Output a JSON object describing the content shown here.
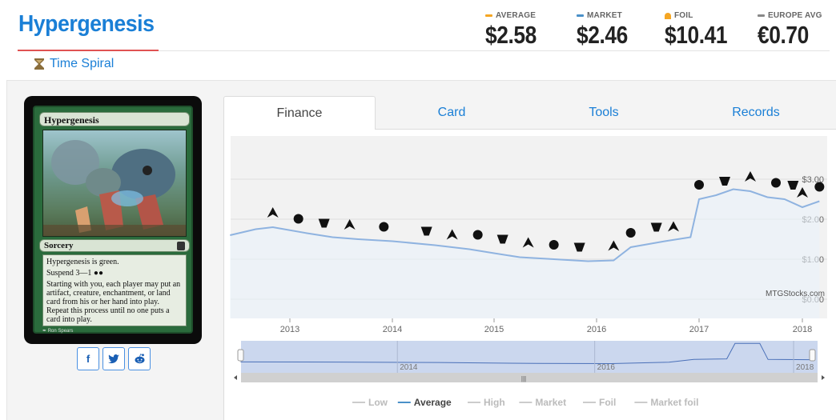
{
  "card": {
    "title": "Hypergenesis",
    "set_name": "Time Spiral",
    "set_icon": "hourglass-icon",
    "name_on_card": "Hypergenesis",
    "type_line": "Sorcery",
    "rules_line1": "Hypergenesis is green.",
    "rules_line2": "Suspend 3—1",
    "rules_line3": "Starting with you, each player may put an artifact, creature, enchantment, or land card from his or her hand into play. Repeat this process until no one puts a card into play.",
    "artist": "Ron Spears"
  },
  "prices": [
    {
      "label": "AVERAGE",
      "value": "$2.58",
      "color": "#f5a623"
    },
    {
      "label": "MARKET",
      "value": "$2.46",
      "color": "#4a90c8"
    },
    {
      "label": "FOIL",
      "value": "$10.41",
      "color": "#f5a623"
    },
    {
      "label": "EUROPE AVG",
      "value": "€0.70",
      "color": "#888888"
    }
  ],
  "share": [
    {
      "name": "facebook-share-button",
      "icon": "facebook-icon",
      "glyph": "f"
    },
    {
      "name": "twitter-share-button",
      "icon": "twitter-icon",
      "glyph": "🐦"
    },
    {
      "name": "reddit-share-button",
      "icon": "reddit-icon",
      "glyph": "👾"
    }
  ],
  "tabs": [
    {
      "label": "Finance",
      "active": true
    },
    {
      "label": "Card",
      "active": false
    },
    {
      "label": "Tools",
      "active": false
    },
    {
      "label": "Records",
      "active": false
    }
  ],
  "chart_data": {
    "type": "line",
    "x_ticks": [
      "2013",
      "2014",
      "2015",
      "2016",
      "2017",
      "2018"
    ],
    "y_ticks": [
      "$3.00",
      "$2.00",
      "$1.00",
      "$0.00"
    ],
    "ylim": [
      0,
      3.2
    ],
    "watermark": "MTGStocks.com",
    "navigator_ticks": [
      "2014",
      "2016",
      "2018"
    ],
    "navigator_handle_glyph": "|||",
    "series": [
      {
        "name": "Average",
        "color": "#8fb3e0",
        "points": [
          [
            "2012-06",
            1.6
          ],
          [
            "2012-09",
            1.75
          ],
          [
            "2012-11",
            1.8
          ],
          [
            "2013-03",
            1.65
          ],
          [
            "2013-06",
            1.55
          ],
          [
            "2013-09",
            1.5
          ],
          [
            "2014-01",
            1.45
          ],
          [
            "2014-06",
            1.35
          ],
          [
            "2014-10",
            1.25
          ],
          [
            "2015-01",
            1.15
          ],
          [
            "2015-04",
            1.05
          ],
          [
            "2015-08",
            1.0
          ],
          [
            "2015-12",
            0.95
          ],
          [
            "2016-03",
            0.97
          ],
          [
            "2016-05",
            1.3
          ],
          [
            "2016-09",
            1.45
          ],
          [
            "2016-12",
            1.55
          ],
          [
            "2017-01",
            2.5
          ],
          [
            "2017-03",
            2.6
          ],
          [
            "2017-05",
            2.75
          ],
          [
            "2017-07",
            2.7
          ],
          [
            "2017-09",
            2.55
          ],
          [
            "2017-11",
            2.5
          ],
          [
            "2018-01",
            2.3
          ],
          [
            "2018-03",
            2.45
          ]
        ]
      }
    ],
    "legend": [
      {
        "label": "Low",
        "color": "#cccccc",
        "active": false
      },
      {
        "label": "Average",
        "color": "#4a90c8",
        "active": true
      },
      {
        "label": "High",
        "color": "#cccccc",
        "active": false
      },
      {
        "label": "Market",
        "color": "#cccccc",
        "active": false
      },
      {
        "label": "Foil",
        "color": "#cccccc",
        "active": false
      },
      {
        "label": "Market foil",
        "color": "#cccccc",
        "active": false
      }
    ]
  }
}
